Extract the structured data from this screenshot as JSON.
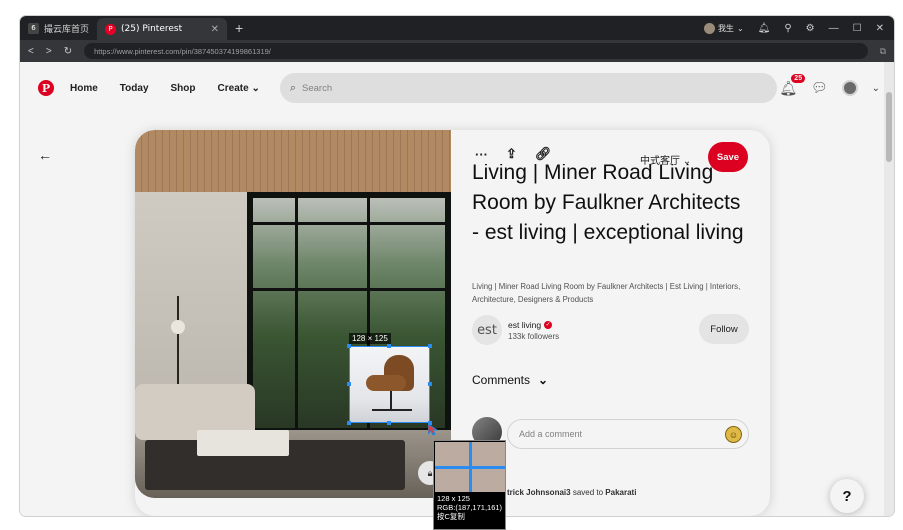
{
  "browser": {
    "tabs": [
      {
        "label": "撮云库首页",
        "active": false
      },
      {
        "label": "(25) Pinterest",
        "active": true
      }
    ],
    "user_name": "我生",
    "url": "https://www.pinterest.com/pin/387450374199861319/"
  },
  "pinterest": {
    "nav": [
      "Home",
      "Today",
      "Shop",
      "Create"
    ],
    "search_placeholder": "Search",
    "notifications_count": "25",
    "pin": {
      "board": "中式客厅",
      "save_label": "Save",
      "title": "Living | Miner Road Living Room by Faulkner Architects - est living | exceptional living",
      "description": "Living | Miner Road Living Room by Faulkner Architects | Est Living | Interiors, Architecture, Designers & Products",
      "creator_logo": "est",
      "creator_name": "est living",
      "followers": "133k followers",
      "follow_label": "Follow",
      "comments_label": "Comments",
      "comment_placeholder": "Add a comment",
      "saved_by": "trick Johnsonai3",
      "saved_text": "saved to",
      "saved_board": "Pakarati"
    },
    "help_label": "?"
  },
  "capture_tool": {
    "selection_size": "128 × 125",
    "magnifier_size": "128 x 125",
    "magnifier_rgb": "RGB:(187,171,161)",
    "magnifier_extra": "按C复制"
  },
  "colors": {
    "brand": "#e60023",
    "selection": "#2a8cf0"
  }
}
